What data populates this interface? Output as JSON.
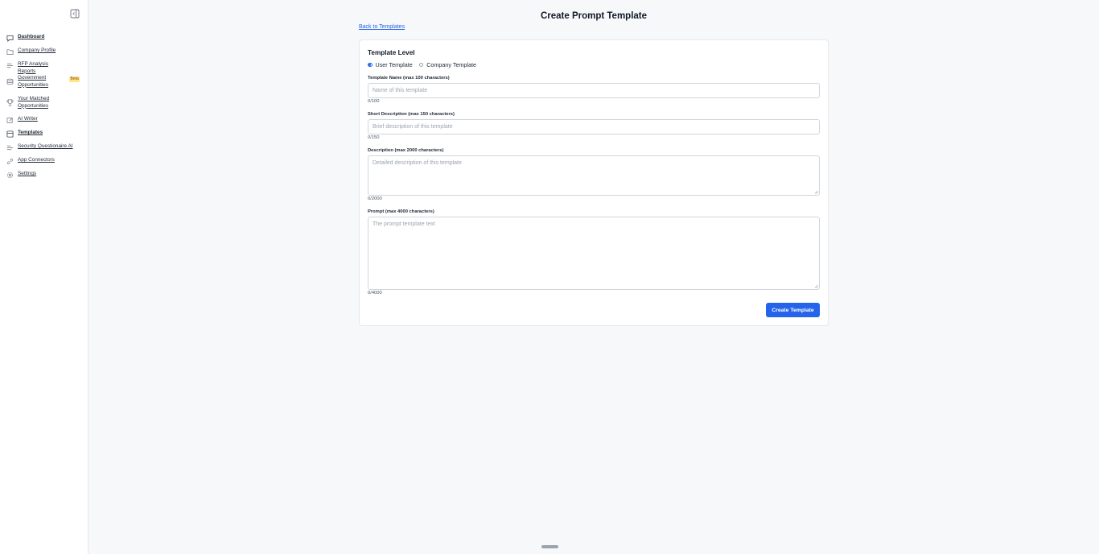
{
  "sidebar": {
    "items": [
      {
        "label": "Dashboard",
        "icon": "chat-icon",
        "active": true
      },
      {
        "label": "Company Profile",
        "icon": "folder-icon"
      },
      {
        "label": "RFP Analysis Reports",
        "icon": "list-icon"
      },
      {
        "label": "Government Opportunities",
        "icon": "database-icon",
        "badge": "Beta"
      },
      {
        "label": "Your Matched Opportunities",
        "icon": "trophy-icon"
      },
      {
        "label": "AI Writer",
        "icon": "pen-icon"
      },
      {
        "label": "Templates",
        "icon": "template-icon",
        "active": true
      },
      {
        "label": "Security Questionaire AI",
        "icon": "shield-icon"
      },
      {
        "label": "App Connectors",
        "icon": "link-icon"
      },
      {
        "label": "Settings",
        "icon": "gear-icon"
      }
    ]
  },
  "page": {
    "title": "Create Prompt Template",
    "back_link": "Back to Templates"
  },
  "form": {
    "template_level": {
      "title": "Template Level",
      "options": [
        "User Template",
        "Company Template"
      ],
      "selected": "User Template"
    },
    "name": {
      "label": "Template Name (max 100 characters)",
      "placeholder": "Name of this template",
      "counter": "0/100"
    },
    "short_description": {
      "label": "Short Description (max 150 characters)",
      "placeholder": "Brief description of this template",
      "counter": "0/150"
    },
    "description": {
      "label": "Description (max 2000 characters)",
      "placeholder": "Detailed description of this template",
      "counter": "0/2000"
    },
    "prompt": {
      "label": "Prompt (max 4000 characters)",
      "placeholder": "The prompt template text",
      "counter": "0/4000"
    },
    "submit_label": "Create Template"
  },
  "colors": {
    "accent": "#2563eb",
    "background": "#f6f8fa",
    "badge": "#fde68a"
  }
}
